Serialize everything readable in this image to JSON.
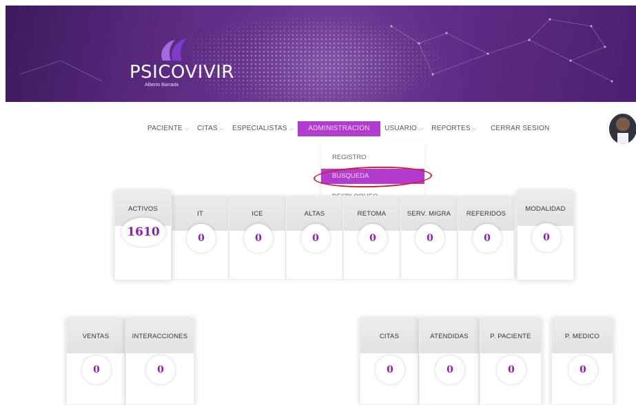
{
  "brand": {
    "name": "PSICOVIVIR",
    "subtitle": "Alberto Barrada"
  },
  "nav": {
    "items": [
      {
        "label": "PACIENTE"
      },
      {
        "label": "CITAS"
      },
      {
        "label": "ESPECIALISTAS"
      },
      {
        "label": "ADMINISTRACION"
      },
      {
        "label": "USUARIO"
      },
      {
        "label": "REPORTES"
      },
      {
        "label": "CERRAR SESION"
      }
    ],
    "active_index": 3
  },
  "dropdown": {
    "items": [
      "REGISTRO",
      "BUSQUEDA",
      "DESBLOQUEO"
    ],
    "selected_index": 1
  },
  "stats_top": [
    {
      "label": "ACTIVOS",
      "value": "1610"
    },
    {
      "label": "IT",
      "value": "0"
    },
    {
      "label": "ICE",
      "value": "0"
    },
    {
      "label": "ALTAS",
      "value": "0"
    },
    {
      "label": "RETOMA",
      "value": "0"
    },
    {
      "label": "SERV. MIGRA",
      "value": "0"
    },
    {
      "label": "REFERIDOS",
      "value": "0"
    },
    {
      "label": "MODALIDAD",
      "value": "0"
    }
  ],
  "stats_bottom_left": [
    {
      "label": "VENTAS",
      "value": "0"
    },
    {
      "label": "INTERACCIONES",
      "value": "0"
    }
  ],
  "stats_bottom_right": [
    {
      "label": "CITAS",
      "value": "0"
    },
    {
      "label": "ATENDIDAS",
      "value": "0"
    },
    {
      "label": "P. PACIENTE",
      "value": "0"
    },
    {
      "label": "P. MEDICO",
      "value": "0"
    }
  ],
  "colors": {
    "accent": "#b23bd0",
    "value": "#8e1fb5",
    "highlight_ring": "#d21f2f",
    "banner": "#5a2a80"
  }
}
